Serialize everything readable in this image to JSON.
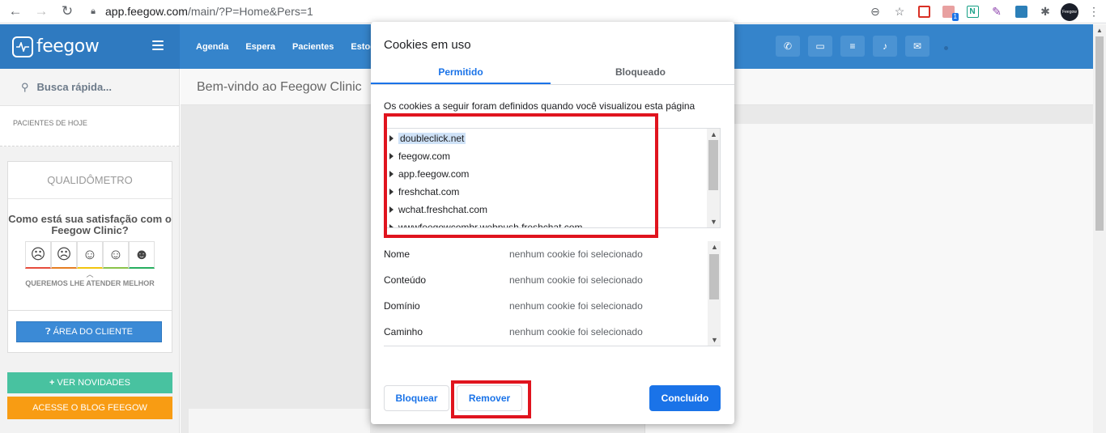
{
  "browser": {
    "url_host": "app.feegow.com",
    "url_path": "/main/?P=Home&Pers=1",
    "ext_badge": "1",
    "ext_n": "N",
    "avatar": "Feegow"
  },
  "header": {
    "logo": "feegow",
    "nav": [
      "Agenda",
      "Espera",
      "Pacientes",
      "Estoque"
    ]
  },
  "sidebar": {
    "search": "Busca rápida...",
    "today": "PACIENTES DE HOJE",
    "quali_title": "QUALIDÔMETRO",
    "quali_question": "Como está sua satisfação com o Feegow Clinic?",
    "quali_sub": "QUEREMOS LHE ATENDER MELHOR",
    "area_button": "ÁREA DO CLIENTE",
    "novidades": "VER NOVIDADES",
    "blog": "ACESSE O BLOG FEEGOW"
  },
  "main": {
    "welcome": "Bem-vindo ao Feegow Clinic"
  },
  "dialog": {
    "title": "Cookies em uso",
    "tabs": [
      "Permitido",
      "Bloqueado"
    ],
    "description": "Os cookies a seguir foram definidos quando você visualizou esta página",
    "domains": [
      "doubleclick.net",
      "feegow.com",
      "app.feegow.com",
      "freshchat.com",
      "wchat.freshchat.com",
      "wwwfeegowcombr.webpush.freshchat.com"
    ],
    "details": [
      {
        "key": "Nome",
        "value": "nenhum cookie foi selecionado"
      },
      {
        "key": "Conteúdo",
        "value": "nenhum cookie foi selecionado"
      },
      {
        "key": "Domínio",
        "value": "nenhum cookie foi selecionado"
      },
      {
        "key": "Caminho",
        "value": "nenhum cookie foi selecionado"
      }
    ],
    "buttons": {
      "block": "Bloquear",
      "remove": "Remover",
      "done": "Concluído"
    }
  },
  "colors": {
    "header_blue": "#3584cb",
    "accent_blue": "#1a73e8",
    "highlight_red": "#e0141e",
    "green": "#48c2a0",
    "orange": "#f89c13"
  }
}
